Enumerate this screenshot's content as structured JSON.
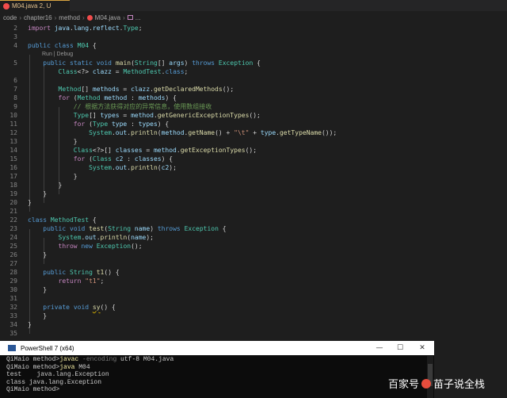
{
  "tab": {
    "label": "M04.java 2, U"
  },
  "breadcrumb": {
    "items": [
      "code",
      "chapter16",
      "method",
      "M04.java",
      "..."
    ]
  },
  "codelens": "Run | Debug",
  "line_numbers": [
    "2",
    "3",
    "4",
    "5",
    "",
    "6",
    "7",
    "8",
    "9",
    "10",
    "11",
    "12",
    "13",
    "14",
    "15",
    "16",
    "17",
    "18",
    "19",
    "20",
    "21",
    "22",
    "23",
    "24",
    "25",
    "26",
    "27",
    "28",
    "29",
    "30",
    "31",
    "32",
    "33",
    "34",
    "35"
  ],
  "terminal": {
    "title": "PowerShell 7 (x64)",
    "lines": [
      {
        "prompt": "QiMaio method>",
        "cmd": "javac",
        "flag": " -encoding",
        "rest": " utf-8 M04.java"
      },
      {
        "prompt": "QiMaio method>",
        "cmd": "java",
        "flag": "",
        "rest": " M04"
      },
      {
        "prompt": "test    java.lang.Exception",
        "cmd": "",
        "flag": "",
        "rest": ""
      },
      {
        "prompt": "class java.lang.Exception",
        "cmd": "",
        "flag": "",
        "rest": ""
      },
      {
        "prompt": "QiMaio method>",
        "cmd": "",
        "flag": "",
        "rest": ""
      }
    ]
  },
  "window_buttons": {
    "minimize": "—",
    "maximize": "☐",
    "close": "✕"
  },
  "watermark": {
    "left": "百家号",
    "right": "苗子说全栈"
  }
}
